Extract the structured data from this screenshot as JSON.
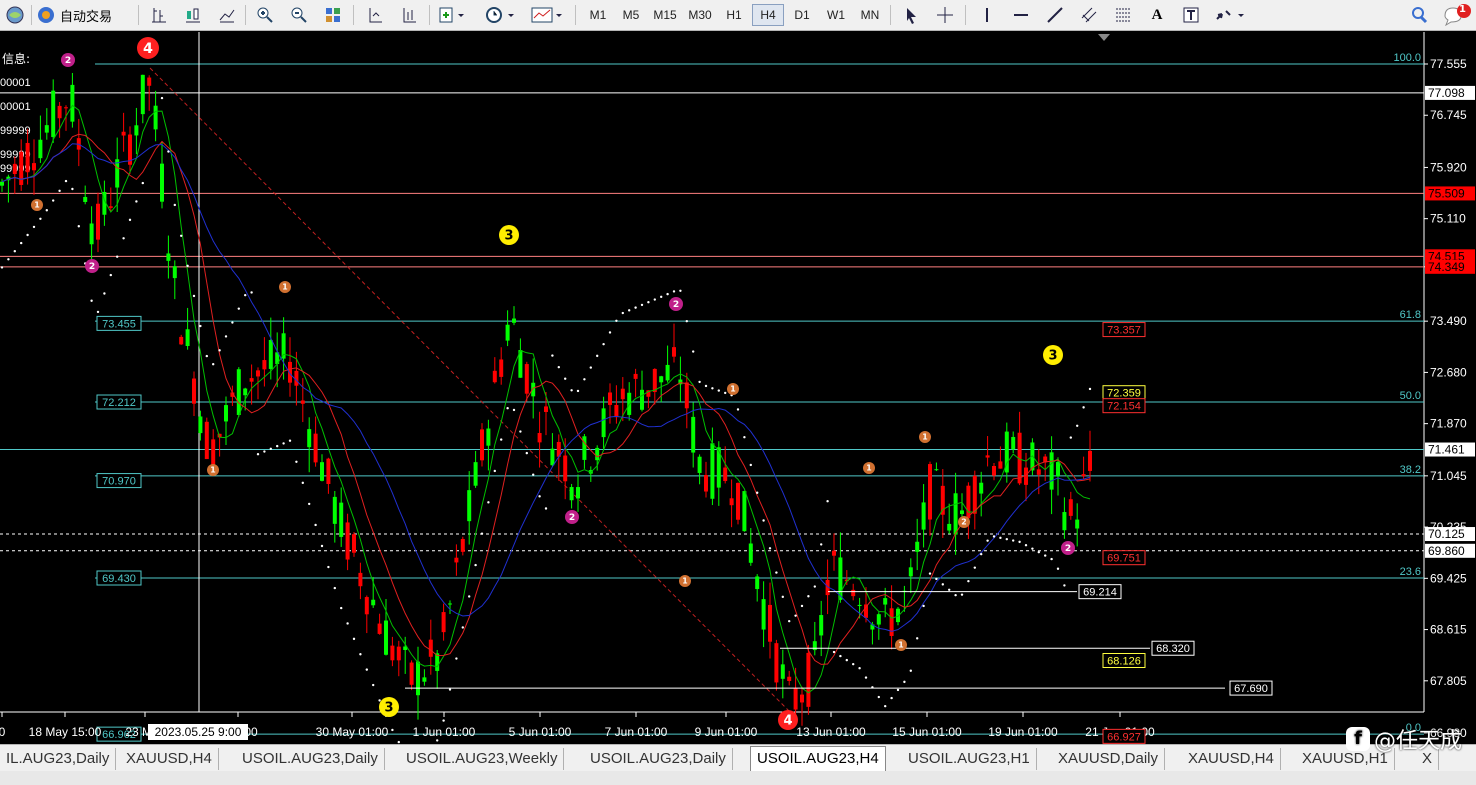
{
  "toolbar": {
    "auto_trade_label": "自动交易",
    "timeframes": [
      "M1",
      "M5",
      "M15",
      "M30",
      "H1",
      "H4",
      "D1",
      "W1",
      "MN"
    ],
    "active_timeframe": "H4",
    "notification_count": "1"
  },
  "chart": {
    "info_label": "信息:",
    "info_values": [
      "00001",
      "00001",
      "99999",
      "99999",
      "99999"
    ],
    "crosshair_time": "2023.05.25 9:00",
    "xticks": [
      "0",
      "18 May 15:00",
      "23 May",
      "y 21:00",
      "30 May 01:00",
      "1 Jun 01:00",
      "5 Jun 01:00",
      "7 Jun 01:00",
      "9 Jun 01:00",
      "13 Jun 01:00",
      "15 Jun 01:00",
      "19 Jun 01:00",
      "21 Jun 01:00"
    ],
    "yticks": [
      "77.555",
      "76.745",
      "75.920",
      "75.110",
      "74.349",
      "73.490",
      "72.680",
      "71.870",
      "71.045",
      "70.235",
      "69.425",
      "68.615",
      "67.805",
      "66.980"
    ],
    "price_boxes": [
      {
        "text": "77.098",
        "style": "white"
      },
      {
        "text": "75.509",
        "style": "red"
      },
      {
        "text": "74.515",
        "style": "red"
      },
      {
        "text": "74.349",
        "style": "red"
      },
      {
        "text": "71.461",
        "style": "white"
      },
      {
        "text": "70.125",
        "style": "white"
      },
      {
        "text": "69.860",
        "style": "white"
      }
    ],
    "fib_levels": [
      "100.0",
      "61.8",
      "50.0",
      "38.2",
      "23.6",
      "0.0"
    ],
    "left_labels": [
      "73.455",
      "72.212",
      "70.970",
      "69.430",
      "66.962"
    ],
    "inner_labels": [
      {
        "text": "73.357",
        "style": "red"
      },
      {
        "text": "72.359",
        "style": "yellow"
      },
      {
        "text": "72.154",
        "style": "red"
      },
      {
        "text": "69.751",
        "style": "red"
      },
      {
        "text": "69.214",
        "style": "white"
      },
      {
        "text": "68.320",
        "style": "white"
      },
      {
        "text": "68.126",
        "style": "yellow"
      },
      {
        "text": "67.690",
        "style": "white"
      },
      {
        "text": "66.927",
        "style": "red"
      }
    ],
    "wave_markers": [
      "4",
      "2",
      "2",
      "3",
      "2",
      "3",
      "1",
      "1",
      "2",
      "2",
      "1",
      "1",
      "1",
      "1",
      "3",
      "2",
      "1",
      "1",
      "4"
    ],
    "colors": {
      "bull": "#00ff00",
      "bear": "#ff0000",
      "ma_fast": "#00c000",
      "ma_mid": "#e02020",
      "ma_slow": "#2030d0",
      "fib": "#50c8c8"
    }
  },
  "tabs": [
    "IL.AUG23,Daily",
    "XAUUSD,H4",
    "USOIL.AUG23,Daily",
    "USOIL.AUG23,Weekly",
    "USOIL.AUG23,Daily",
    "USOIL.AUG23,H4",
    "USOIL.AUG23,H1",
    "XAUUSD,Daily",
    "XAUUSD,H4",
    "XAUUSD,H1",
    "X"
  ],
  "active_tab": "USOIL.AUG23,H4",
  "watermark": {
    "logo": "f",
    "text": "@任天成"
  }
}
